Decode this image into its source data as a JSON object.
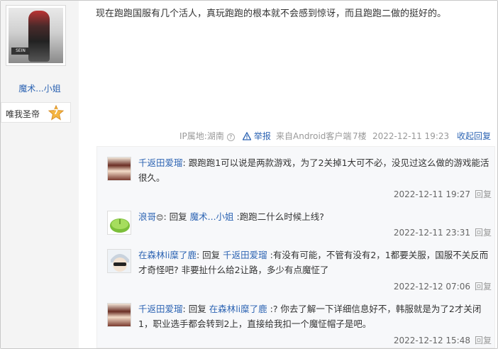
{
  "author": {
    "avatar_logo": "SEIN",
    "name": "魔术...小姐",
    "badge_label": "唯我圣帝",
    "level": "7"
  },
  "post": {
    "text": "现在跑跑国服有几个活人，真玩跑跑的根本就不会感到惊讶，而且跑跑二做的挺好的。",
    "ip_label": "IP属地:湖南",
    "report": "举报",
    "source": "来自Android客户端",
    "floor": "7楼",
    "time": "2022-12-11 19:23",
    "collapse": "收起回复"
  },
  "replies": [
    {
      "nick": "千返田爱瑠",
      "reply_word": "",
      "target": "",
      "text": ": 跟跑跑1可以说是两款游戏，为了2关掉1大可不必，没见过这么做的游戏能活很久。",
      "time": "2022-12-11 19:27",
      "reply_label": "回复"
    },
    {
      "nick": "浪哥",
      "reply_word": ": 回复 ",
      "target": "魔术...小姐",
      "text": " :跑跑二什么时候上线?",
      "time": "2022-12-11 23:31",
      "reply_label": "回复"
    },
    {
      "nick": "在森林li糜了鹿",
      "reply_word": ": 回复 ",
      "target": "千返田爱瑠",
      "text": " :有没有可能，不管有没有2，1都要关服，国服不关反而才奇怪吧? 非要扯什么给2让路，多少有点魔怔了",
      "time": "2022-12-12 07:06",
      "reply_label": "回复"
    },
    {
      "nick": "千返田爱瑠",
      "reply_word": ": 回复 ",
      "target": "在森林li糜了鹿",
      "text": " :? 你去了解一下详细信息好不，韩服就是为了2才关闭1，职业选手都会转到2上，直接给我扣一个魔怔帽子是吧。",
      "time": "2022-12-12 15:48",
      "reply_label": "回复"
    }
  ]
}
